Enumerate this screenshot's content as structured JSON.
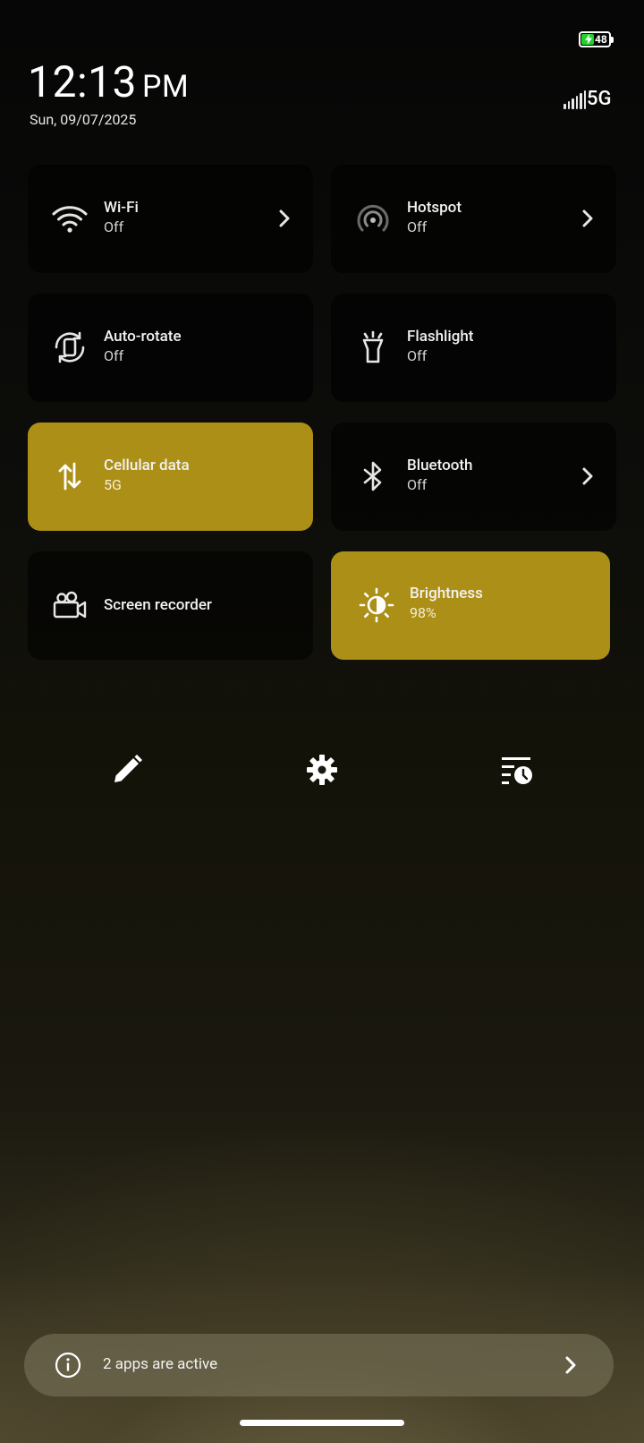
{
  "status_bar": {
    "battery_level": "48",
    "battery_fill_fraction": 0.48,
    "battery_charging": true,
    "network_type": "5G",
    "signal_icon": "signal-bars-icon"
  },
  "header": {
    "time": "12:13",
    "ampm": "PM",
    "date": "Sun, 09/07/2025"
  },
  "tiles": {
    "wifi": {
      "label": "Wi-Fi",
      "status": "Off",
      "icon": "wifi-icon",
      "active": false,
      "has_chevron": true
    },
    "hotspot": {
      "label": "Hotspot",
      "status": "Off",
      "icon": "hotspot-icon",
      "active": false,
      "has_chevron": true
    },
    "autorotate": {
      "label": "Auto-rotate",
      "status": "Off",
      "icon": "auto-rotate-icon",
      "active": false
    },
    "flashlight": {
      "label": "Flashlight",
      "status": "Off",
      "icon": "flashlight-icon",
      "active": false
    },
    "cellular": {
      "label": "Cellular data",
      "status": "5G",
      "icon": "cellular-data-icon",
      "active": true
    },
    "bluetooth": {
      "label": "Bluetooth",
      "status": "Off",
      "icon": "bluetooth-icon",
      "active": false,
      "has_chevron": true
    },
    "screen_recorder": {
      "label": "Screen recorder",
      "icon": "video-camera-icon",
      "active": false
    },
    "brightness": {
      "label": "Brightness",
      "status": "98%",
      "value_percent": 98,
      "icon": "brightness-icon",
      "active": true
    }
  },
  "toolbar": {
    "edit_icon": "pencil-icon",
    "settings_icon": "gear-icon",
    "history_icon": "history-list-icon"
  },
  "active_apps": {
    "label": "2 apps are active",
    "icon": "info-icon"
  },
  "colors": {
    "accent": "#ac8f17",
    "tile_inactive": "#0b0b09",
    "battery_green": "#1fd32a"
  }
}
